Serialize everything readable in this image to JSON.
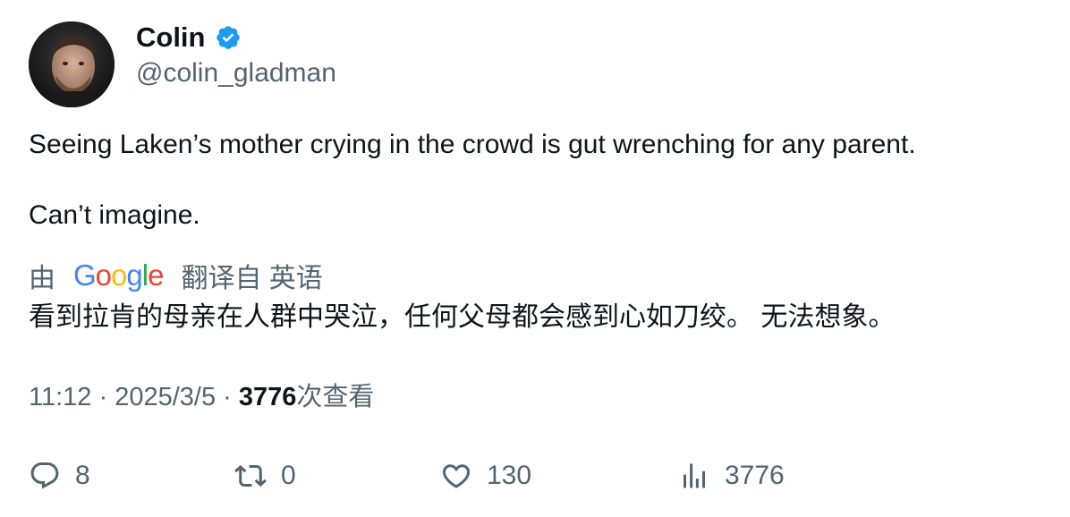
{
  "author": {
    "name": "Colin",
    "handle": "@colin_gladman",
    "verified": true
  },
  "tweet": {
    "text_line1": "Seeing Laken’s mother crying in the crowd is gut wrenching for any parent.",
    "text_line2": "Can’t imagine.",
    "translation": {
      "prefix": "由",
      "provider": "Google",
      "suffix": "翻译自 英语",
      "text": "看到拉肯的母亲在人群中哭泣，任何父母都会感到心如刀绞。 无法想象。"
    },
    "meta": {
      "time": "11:12",
      "separator": " · ",
      "date": "2025/3/5",
      "views": "3776",
      "views_label": "次查看"
    }
  },
  "actions": {
    "replies": "8",
    "retweets": "0",
    "likes": "130",
    "views": "3776"
  },
  "colors": {
    "text": "#0f1419",
    "secondary": "#536471",
    "verified": "#1d9bf0"
  },
  "icons": [
    "verified-badge-icon",
    "reply-icon",
    "retweet-icon",
    "like-icon",
    "views-icon"
  ]
}
